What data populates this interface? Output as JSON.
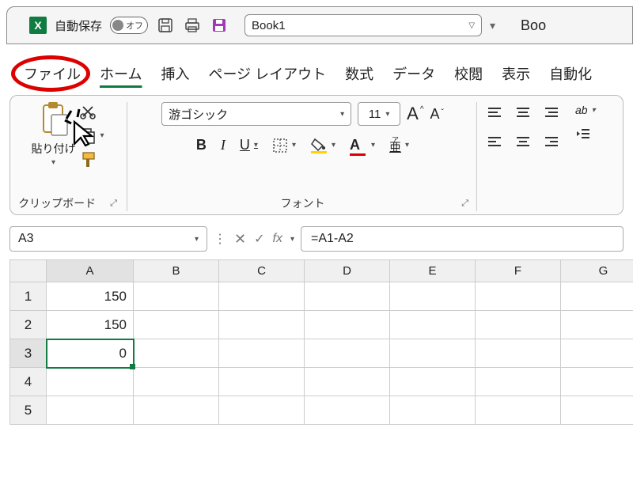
{
  "titlebar": {
    "autosave_label": "自動保存",
    "autosave_state": "オフ",
    "workbook_name": "Book1",
    "overflow_title": "Boo"
  },
  "tabs": {
    "file": "ファイル",
    "home": "ホーム",
    "insert": "挿入",
    "page_layout": "ページ レイアウト",
    "formulas": "数式",
    "data": "データ",
    "review": "校閲",
    "view": "表示",
    "automate": "自動化"
  },
  "ribbon": {
    "clipboard": {
      "paste_label": "貼り付け",
      "group_label": "クリップボード"
    },
    "font": {
      "name": "游ゴシック",
      "size": "11",
      "group_label": "フォント"
    }
  },
  "formula_bar": {
    "name_box": "A3",
    "formula": "=A1-A2"
  },
  "grid": {
    "columns": [
      "A",
      "B",
      "C",
      "D",
      "E",
      "F",
      "G"
    ],
    "rows": [
      {
        "hdr": "1",
        "cells": [
          "150",
          "",
          "",
          "",
          "",
          "",
          ""
        ]
      },
      {
        "hdr": "2",
        "cells": [
          "150",
          "",
          "",
          "",
          "",
          "",
          ""
        ]
      },
      {
        "hdr": "3",
        "cells": [
          "0",
          "",
          "",
          "",
          "",
          "",
          ""
        ]
      },
      {
        "hdr": "4",
        "cells": [
          "",
          "",
          "",
          "",
          "",
          "",
          ""
        ]
      },
      {
        "hdr": "5",
        "cells": [
          "",
          "",
          "",
          "",
          "",
          "",
          ""
        ]
      }
    ],
    "selected": {
      "row": 3,
      "col": "A"
    }
  },
  "icons": {
    "save_disk": "save-icon",
    "print": "print-icon",
    "save_purple": "save-purple-icon"
  }
}
